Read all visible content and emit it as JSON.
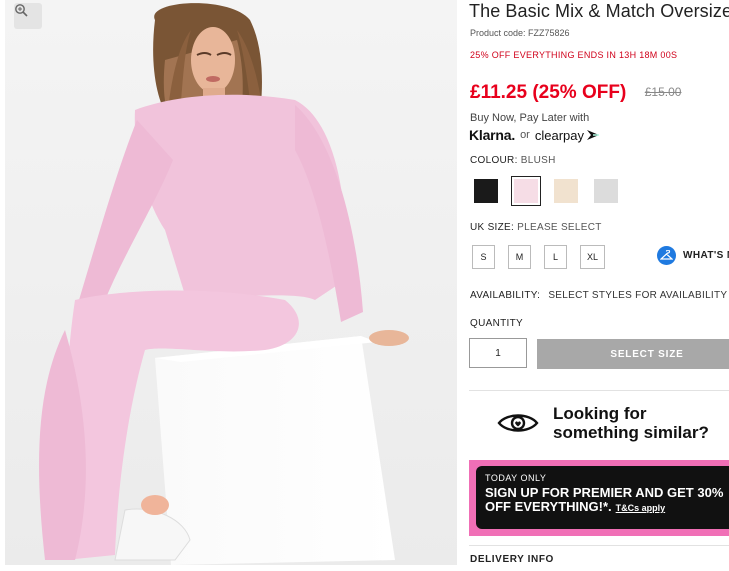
{
  "product": {
    "title": "The Basic Mix & Match Oversized",
    "code": "Product code: FZZ75826",
    "promo_prefix": "25% OFF EVERYTHING ENDS IN",
    "promo_timer": "13H 18M 00S",
    "price_now": "£11.25 (25% OFF)",
    "price_was": "£15.00"
  },
  "payment": {
    "label": "Buy Now, Pay Later with",
    "klarna": "Klarna.",
    "or": "or",
    "clearpay": "clearpay"
  },
  "colour": {
    "label": "COLOUR:",
    "selected": "BLUSH",
    "swatches": [
      {
        "name": "Black",
        "color": "#1a1a1a"
      },
      {
        "name": "Blush",
        "color": "#f6dde6"
      },
      {
        "name": "Stone",
        "color": "#f1e2cf"
      },
      {
        "name": "Grey",
        "color": "#dcdcdc"
      }
    ]
  },
  "size": {
    "label": "UK SIZE:",
    "selected": "PLEASE SELECT",
    "options": [
      "S",
      "M",
      "L",
      "XL"
    ],
    "guide": "WHAT'S MY SIZE?"
  },
  "availability": {
    "label": "AVAILABILITY:",
    "value": "SELECT STYLES FOR AVAILABILITY"
  },
  "quantity": {
    "label": "QUANTITY",
    "value": "1"
  },
  "add_button": "SELECT SIZE",
  "similar": {
    "line1": "Looking for",
    "line2": "something similar?"
  },
  "premier": {
    "tag": "TODAY ONLY",
    "line1": "SIGN UP FOR PREMIER AND GET 30%",
    "line2": "OFF EVERYTHING!*.",
    "tcs": "T&Cs apply"
  },
  "delivery": "DELIVERY INFO",
  "icons": {
    "zoom": "zoom-icon",
    "hanger": "hanger-icon",
    "eye": "eye-icon"
  },
  "colors": {
    "sale_red": "#e8001c",
    "premier_pink": "#f06fb6",
    "button_grey": "#a8a8a8"
  }
}
